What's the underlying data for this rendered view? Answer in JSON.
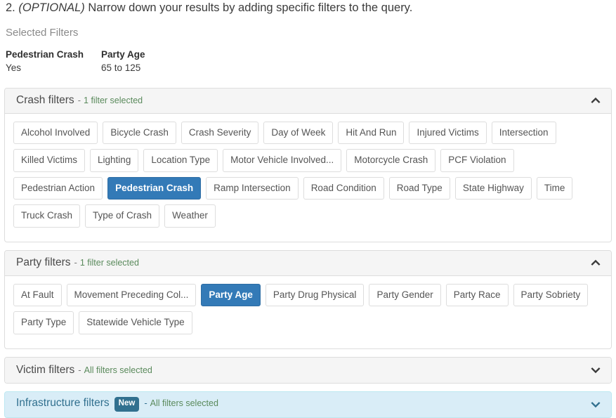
{
  "step": {
    "number": "2.",
    "optional": "(OPTIONAL)",
    "text": "Narrow down your results by adding specific filters to the query."
  },
  "selected_filters": {
    "title": "Selected Filters",
    "items": [
      {
        "name": "Pedestrian Crash",
        "value": "Yes"
      },
      {
        "name": "Party Age",
        "value": "65 to 125"
      }
    ]
  },
  "colors": {
    "selected_pill_bg": "#337ab7",
    "selected_pill_border": "#2e6da4",
    "status_green": "#5a8a5c",
    "info_panel_bg": "#d9edf7",
    "info_panel_border": "#bce8f1",
    "info_text": "#31708f",
    "panel_heading_bg": "#f5f5f5",
    "panel_border": "#dddddd"
  },
  "panels": [
    {
      "title": "Crash filters",
      "dash": "-",
      "status": "1 filter selected",
      "expanded": true,
      "chevron": "chevron-up-icon",
      "badge": null,
      "info": false,
      "pills": [
        {
          "label": "Alcohol Involved",
          "selected": false
        },
        {
          "label": "Bicycle Crash",
          "selected": false
        },
        {
          "label": "Crash Severity",
          "selected": false
        },
        {
          "label": "Day of Week",
          "selected": false
        },
        {
          "label": "Hit And Run",
          "selected": false
        },
        {
          "label": "Injured Victims",
          "selected": false
        },
        {
          "label": "Intersection",
          "selected": false
        },
        {
          "label": "Killed Victims",
          "selected": false
        },
        {
          "label": "Lighting",
          "selected": false
        },
        {
          "label": "Location Type",
          "selected": false
        },
        {
          "label": "Motor Vehicle Involved...",
          "selected": false
        },
        {
          "label": "Motorcycle Crash",
          "selected": false
        },
        {
          "label": "PCF Violation",
          "selected": false
        },
        {
          "label": "Pedestrian Action",
          "selected": false
        },
        {
          "label": "Pedestrian Crash",
          "selected": true
        },
        {
          "label": "Ramp Intersection",
          "selected": false
        },
        {
          "label": "Road Condition",
          "selected": false
        },
        {
          "label": "Road Type",
          "selected": false
        },
        {
          "label": "State Highway",
          "selected": false
        },
        {
          "label": "Time",
          "selected": false
        },
        {
          "label": "Truck Crash",
          "selected": false
        },
        {
          "label": "Type of Crash",
          "selected": false
        },
        {
          "label": "Weather",
          "selected": false
        }
      ]
    },
    {
      "title": "Party filters",
      "dash": "-",
      "status": "1 filter selected",
      "expanded": true,
      "chevron": "chevron-up-icon",
      "badge": null,
      "info": false,
      "pills": [
        {
          "label": "At Fault",
          "selected": false
        },
        {
          "label": "Movement Preceding Col...",
          "selected": false
        },
        {
          "label": "Party Age",
          "selected": true
        },
        {
          "label": "Party Drug Physical",
          "selected": false
        },
        {
          "label": "Party Gender",
          "selected": false
        },
        {
          "label": "Party Race",
          "selected": false
        },
        {
          "label": "Party Sobriety",
          "selected": false
        },
        {
          "label": "Party Type",
          "selected": false
        },
        {
          "label": "Statewide Vehicle Type",
          "selected": false
        }
      ]
    },
    {
      "title": "Victim filters",
      "dash": "-",
      "status": "All filters selected",
      "expanded": false,
      "chevron": "chevron-down-icon",
      "badge": null,
      "info": false,
      "pills": []
    },
    {
      "title": "Infrastructure filters",
      "dash": "-",
      "status": "All filters selected",
      "expanded": false,
      "chevron": "chevron-down-icon",
      "badge": "New",
      "info": true,
      "pills": []
    }
  ]
}
